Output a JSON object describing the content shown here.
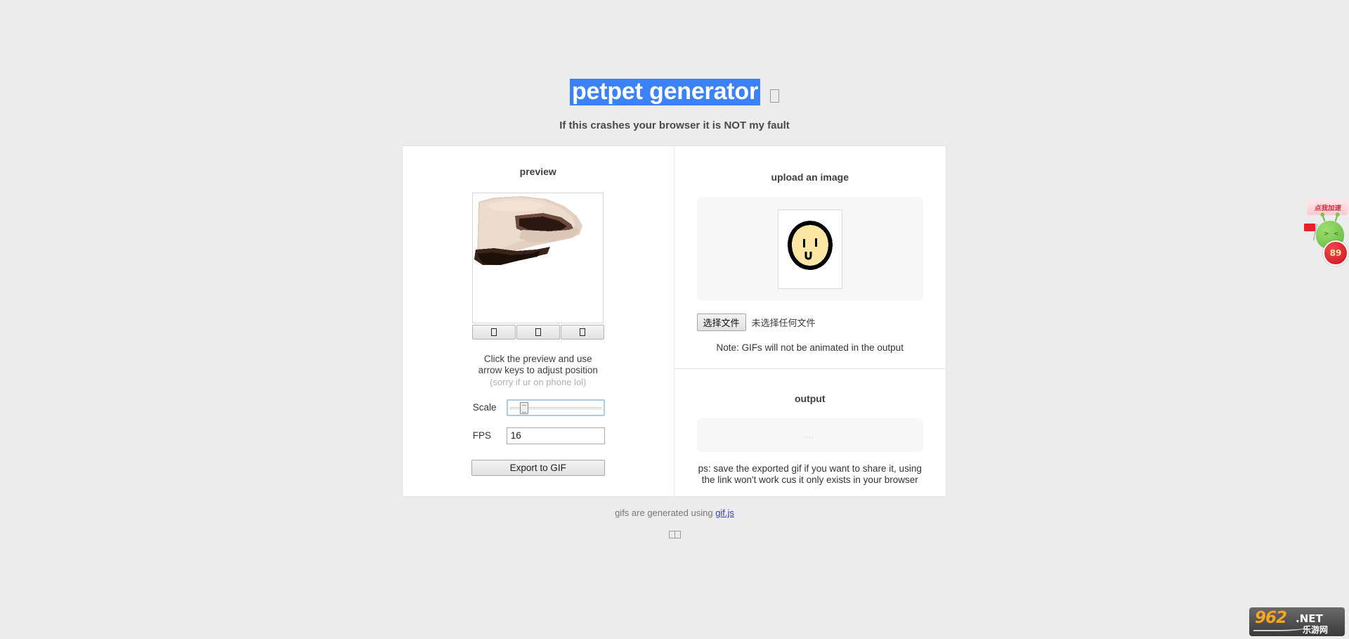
{
  "page": {
    "title": "petpet generator",
    "subtitle": "If this crashes your browser it is NOT my fault",
    "title_selected": true,
    "selection_color": "#3b82f6",
    "background_color": "#ececec"
  },
  "preview": {
    "heading": "preview",
    "hint_line1": "Click the preview and use",
    "hint_line2": "arrow keys to adjust position",
    "hint_line3": "(sorry if ur on phone lol)",
    "buttons": [
      {
        "name": "preview-button-1",
        "label": "□"
      },
      {
        "name": "preview-button-2",
        "label": "□"
      },
      {
        "name": "preview-button-3",
        "label": "□"
      }
    ],
    "controls": {
      "scale_label": "Scale",
      "scale_value": 12,
      "scale_min": 0,
      "scale_max": 100,
      "fps_label": "FPS",
      "fps_value": "16",
      "export_label": "Export to GIF"
    }
  },
  "upload": {
    "heading": "upload an image",
    "file_button_label": "选择文件",
    "file_status": "未选择任何文件",
    "note": "Note: GIFs will not be animated in the output"
  },
  "output": {
    "heading": "output",
    "placeholder": "...",
    "ps_line1": "ps: save the exported gif if you want to share it, using",
    "ps_line2": "the link won't work cus it only exists in your browser"
  },
  "footer": {
    "text": "gifs are generated using",
    "link_label": "gif.js",
    "tofu_label": "□□"
  },
  "ad_widget": {
    "bubble_text": "点我加速",
    "badge_value": "89",
    "bubble_color": "#ffc9d1",
    "badge_color": "#cf1220"
  },
  "watermark": {
    "number": "962",
    "tld": ".NET",
    "cn": "乐游网"
  }
}
